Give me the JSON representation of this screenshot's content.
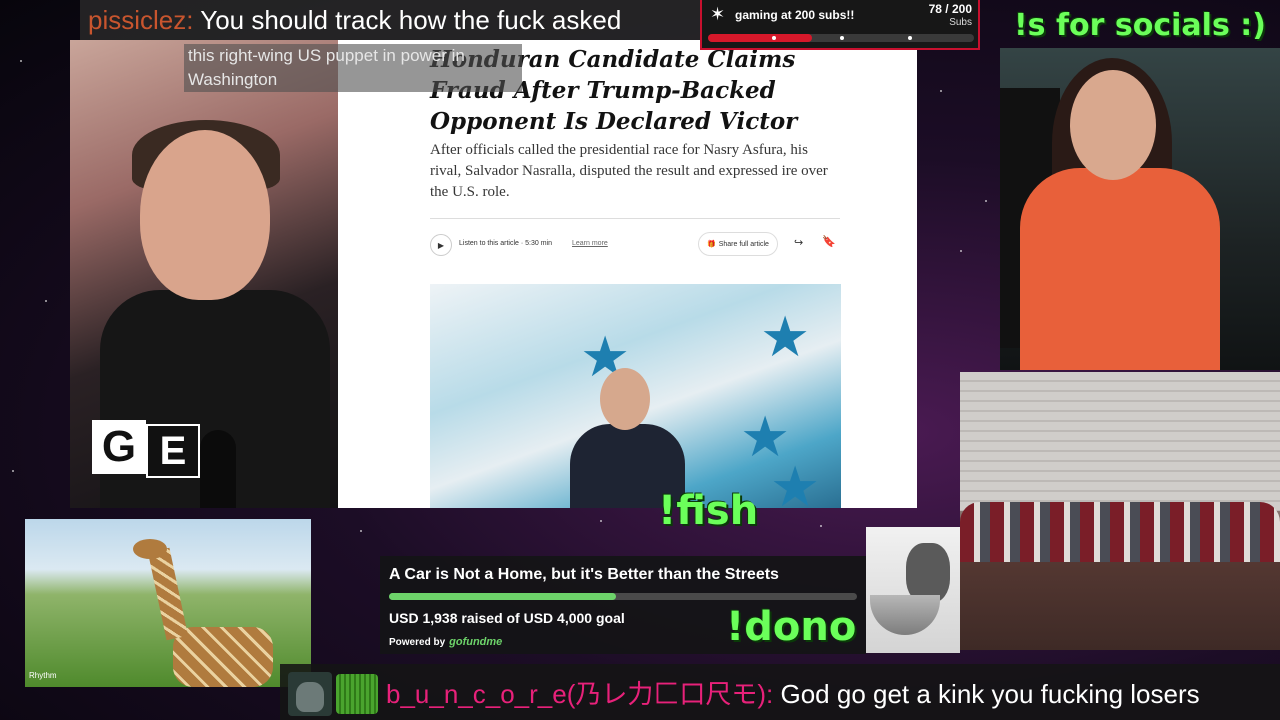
{
  "chat_top": {
    "user": "pissiclez:",
    "message": " You should track how the fuck asked"
  },
  "chat_sub": {
    "text": "this right-wing US puppet in power in Washington"
  },
  "sub_goal": {
    "title": "gaming at 200 subs!!",
    "count": "78 / 200",
    "label": "Subs",
    "progress": 0.39,
    "accent": "#d6182a"
  },
  "socials_label": "!s for socials :)",
  "article": {
    "headline": "Honduran Candidate Claims Fraud After Trump-Backed Opponent Is Declared Victor",
    "summary": "After officials called the presidential race for Nasry Asfura, his rival, Salvador Nasralla, disputed the result and expressed ire over the U.S. role.",
    "listen": "Listen to this article · 5:30 min",
    "learn_more": "Learn more",
    "share_full": "Share full article"
  },
  "logo": {
    "left": "G",
    "right": "E"
  },
  "fish_label": "!fish",
  "dono_label": "!dono",
  "giraffe": {
    "watermark": "Rhythm"
  },
  "gofundme": {
    "title": "A Car is Not a Home, but it's Better than the Streets",
    "raised": "USD 1,938 raised of USD 4,000 goal",
    "powered": "Powered by",
    "brand": "gofundme",
    "progress": 0.4845,
    "accent": "#6dd36a"
  },
  "chat_bottom": {
    "user": "b_u_n_c_o_r_e(乃レ力匚口尺モ):",
    "message": " God go get a kink you fucking losers"
  },
  "colors": {
    "overlay_green": "#6bff5a",
    "chat_user_pink": "#e8217a",
    "chat_user_orange": "#c8552e"
  }
}
